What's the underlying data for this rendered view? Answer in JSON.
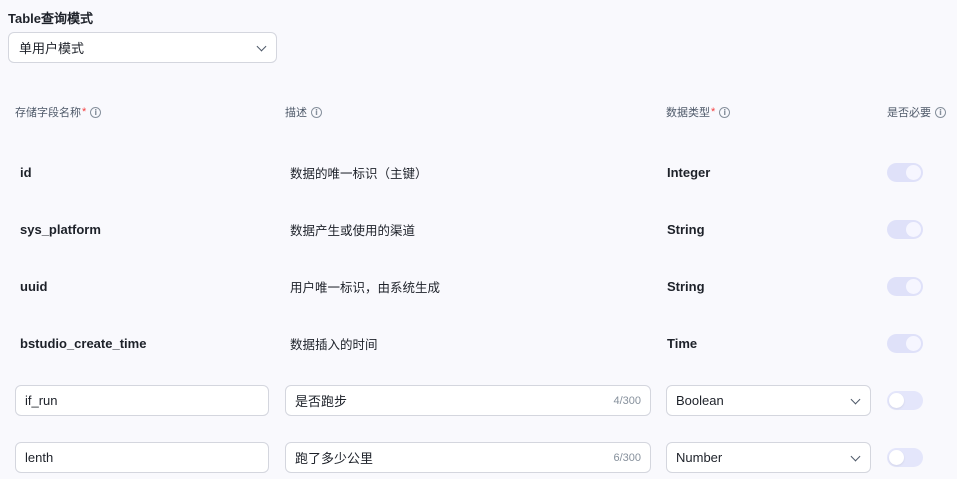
{
  "query_mode": {
    "title": "Table查询模式",
    "selected": "单用户模式"
  },
  "columns": {
    "field_name": "存储字段名称",
    "description": "描述",
    "data_type": "数据类型",
    "required": "是否必要",
    "required_marker": "*",
    "info_glyph": "i"
  },
  "rows": [
    {
      "name": "id",
      "description": "数据的唯一标识（主键）",
      "type": "Integer",
      "required": true
    },
    {
      "name": "sys_platform",
      "description": "数据产生或使用的渠道",
      "type": "String",
      "required": true
    },
    {
      "name": "uuid",
      "description": "用户唯一标识，由系统生成",
      "type": "String",
      "required": true
    },
    {
      "name": "bstudio_create_time",
      "description": "数据插入的时间",
      "type": "Time",
      "required": true
    }
  ],
  "editable_rows": [
    {
      "name": "if_run",
      "description": "是否跑步",
      "counter": "4/300",
      "type": "Boolean",
      "required": false
    },
    {
      "name": "lenth",
      "description": "跑了多少公里",
      "counter": "6/300",
      "type": "Number",
      "required": false
    }
  ],
  "icons": {
    "chevron": "chevron-down-icon",
    "info": "info-circle-icon"
  }
}
